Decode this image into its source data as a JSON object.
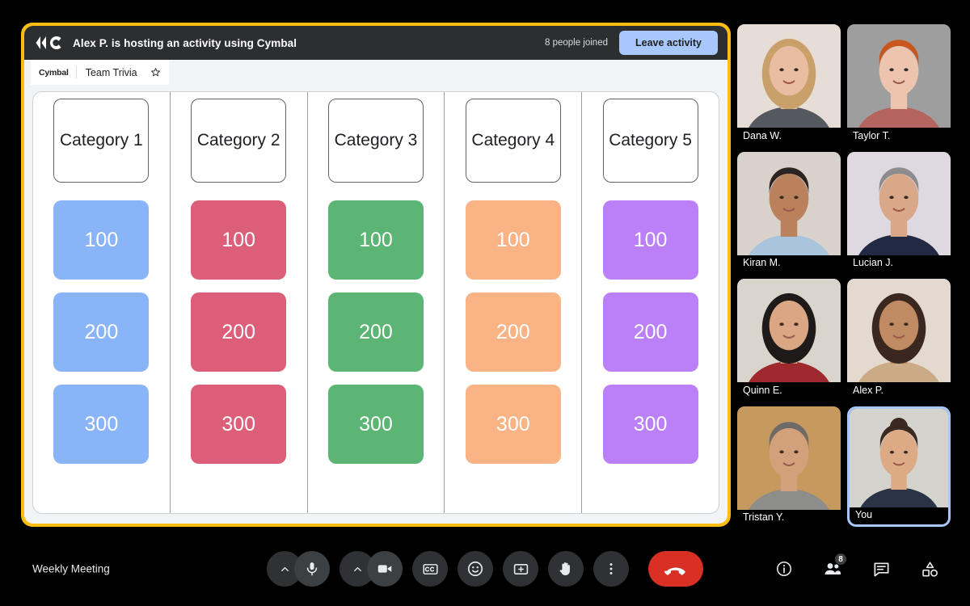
{
  "activity": {
    "logo_icon": "cymbal-logo-icon",
    "host_banner": "Alex P. is hosting an activity using Cymbal",
    "joined_count_label": "8 people joined",
    "leave_label": "Leave activity",
    "brand": "Cymbal",
    "tab_name": "Team Trivia",
    "star_icon": "star-outline-icon"
  },
  "board": {
    "columns": [
      {
        "category": "Category 1",
        "color": "#8ab4f8",
        "tiles": [
          "100",
          "200",
          "300"
        ]
      },
      {
        "category": "Category 2",
        "color": "#dd5e79",
        "tiles": [
          "100",
          "200",
          "300"
        ]
      },
      {
        "category": "Category 3",
        "color": "#5cb574",
        "tiles": [
          "100",
          "200",
          "300"
        ]
      },
      {
        "category": "Category 4",
        "color": "#f9b384",
        "tiles": [
          "100",
          "200",
          "300"
        ]
      },
      {
        "category": "Category 5",
        "color": "#bb80f7",
        "tiles": [
          "100",
          "200",
          "300"
        ]
      }
    ]
  },
  "participants": [
    {
      "name": "Dana W.",
      "self": false
    },
    {
      "name": "Taylor T.",
      "self": false
    },
    {
      "name": "Kiran M.",
      "self": false
    },
    {
      "name": "Lucian J.",
      "self": false
    },
    {
      "name": "Quinn E.",
      "self": false
    },
    {
      "name": "Alex P.",
      "self": false
    },
    {
      "name": "Tristan Y.",
      "self": false
    },
    {
      "name": "You",
      "self": true
    }
  ],
  "bottom_bar": {
    "meeting_name": "Weekly Meeting",
    "controls": [
      {
        "name": "microphone-button",
        "icon": "microphone-icon"
      },
      {
        "name": "camera-button",
        "icon": "video-camera-icon"
      },
      {
        "name": "captions-button",
        "icon": "closed-captions-icon"
      },
      {
        "name": "reactions-button",
        "icon": "smiley-face-icon"
      },
      {
        "name": "present-screen-button",
        "icon": "present-screen-icon"
      },
      {
        "name": "raise-hand-button",
        "icon": "raised-hand-icon"
      },
      {
        "name": "more-options-button",
        "icon": "more-vertical-icon"
      },
      {
        "name": "end-call-button",
        "icon": "phone-hangup-icon"
      }
    ],
    "right_icons": [
      {
        "name": "meeting-details-button",
        "icon": "info-circle-icon",
        "badge": ""
      },
      {
        "name": "people-button",
        "icon": "people-icon",
        "badge": "8"
      },
      {
        "name": "chat-button",
        "icon": "chat-bubble-icon",
        "badge": ""
      },
      {
        "name": "activities-button",
        "icon": "activities-shapes-icon",
        "badge": ""
      }
    ]
  },
  "colors": {
    "accent_yellow": "#fdbc11",
    "accent_blue": "#a8c7fa",
    "end_call_red": "#d93025"
  }
}
